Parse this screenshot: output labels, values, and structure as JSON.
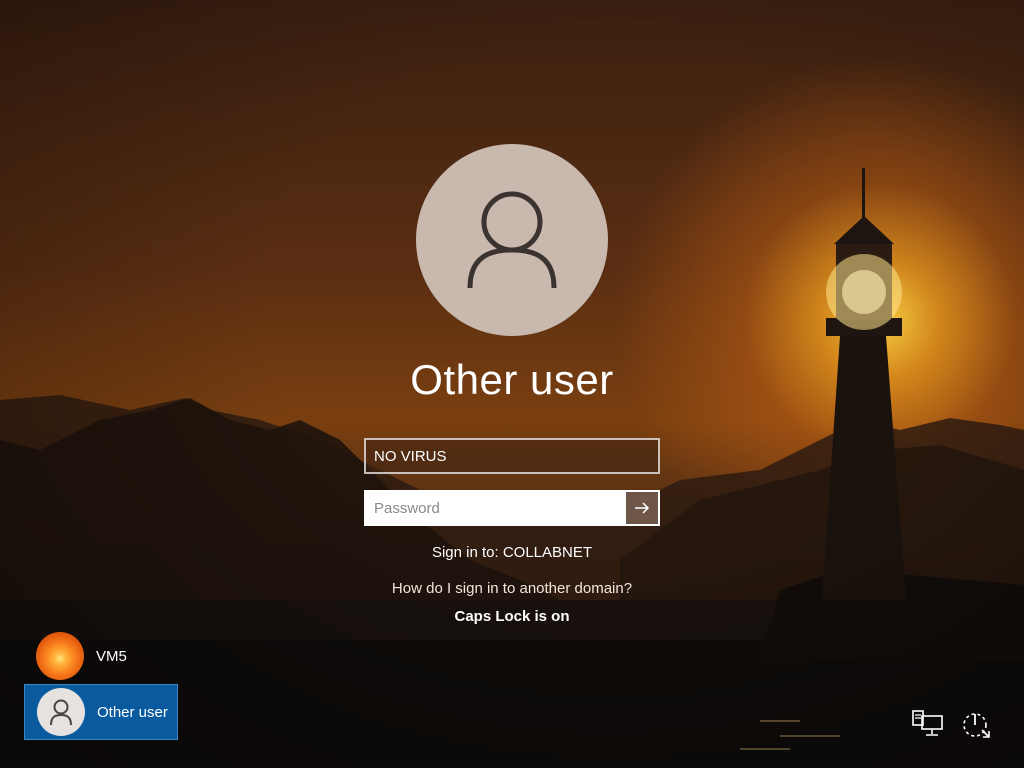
{
  "login": {
    "title": "Other user",
    "username_value": "NO VIRUS",
    "password_placeholder": "Password",
    "sign_in_to": "Sign in to: COLLABNET",
    "domain_help_link": "How do I sign in to another domain?",
    "caps_lock_warning": "Caps Lock is on"
  },
  "user_list": [
    {
      "name": "VM5",
      "avatar": "flower-avatar",
      "selected": false
    },
    {
      "name": "Other user",
      "avatar": "person-icon",
      "selected": true
    }
  ],
  "system_tray": {
    "network_icon": "network-icon",
    "power_icon": "power-icon"
  },
  "colors": {
    "selected_tile": "#0a5aa0",
    "avatar_bg": "#c8b8ae",
    "submit_button": "#6e5648"
  }
}
